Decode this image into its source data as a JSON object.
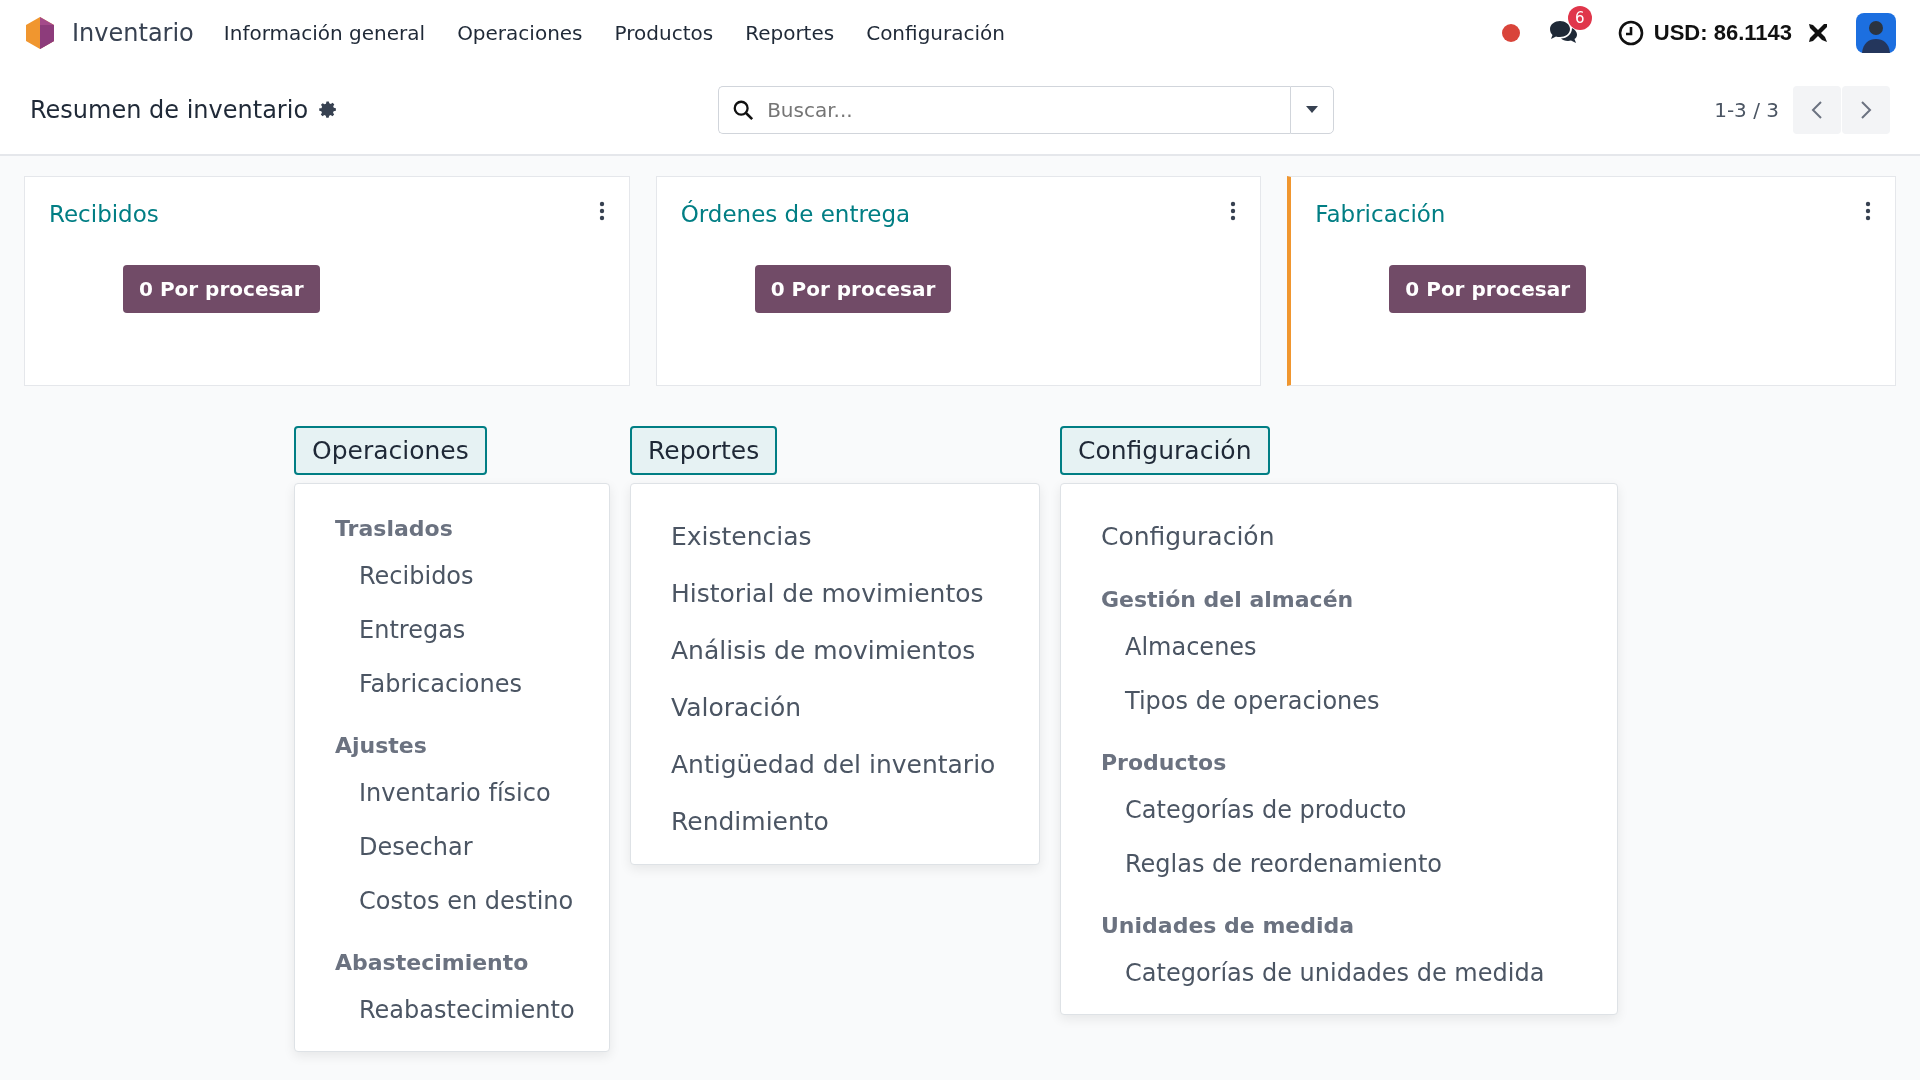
{
  "navbar": {
    "app_name": "Inventario",
    "menu": [
      "Información general",
      "Operaciones",
      "Productos",
      "Reportes",
      "Configuración"
    ],
    "messages_badge": "6",
    "currency": "USD: 86.1143"
  },
  "control_panel": {
    "title": "Resumen de inventario",
    "search": {
      "placeholder": "Buscar..."
    },
    "pager": "1-3 / 3"
  },
  "cards": [
    {
      "title": "Recibidos",
      "button": "0 Por procesar",
      "accent": false
    },
    {
      "title": "Órdenes de entrega",
      "button": "0 Por procesar",
      "accent": false
    },
    {
      "title": "Fabricación",
      "button": "0 Por procesar",
      "accent": true
    }
  ],
  "menus": [
    {
      "title": "Operaciones",
      "entries": [
        {
          "kind": "group",
          "label": "Traslados",
          "children": [
            {
              "label": "Recibidos"
            },
            {
              "label": "Entregas"
            },
            {
              "label": "Fabricaciones"
            }
          ]
        },
        {
          "kind": "group",
          "label": "Ajustes",
          "children": [
            {
              "label": "Inventario físico"
            },
            {
              "label": "Desechar"
            },
            {
              "label": "Costos en destino"
            }
          ]
        },
        {
          "kind": "group",
          "label": "Abastecimiento",
          "children": [
            {
              "label": "Reabastecimiento"
            }
          ]
        }
      ]
    },
    {
      "title": "Reportes",
      "entries": [
        {
          "kind": "item",
          "label": "Existencias"
        },
        {
          "kind": "item",
          "label": "Historial de movimientos"
        },
        {
          "kind": "item",
          "label": "Análisis de movimientos"
        },
        {
          "kind": "item",
          "label": "Valoración"
        },
        {
          "kind": "item",
          "label": "Antigüedad del inventario"
        },
        {
          "kind": "item",
          "label": "Rendimiento"
        }
      ]
    },
    {
      "title": "Configuración",
      "entries": [
        {
          "kind": "item",
          "label": "Configuración"
        },
        {
          "kind": "group",
          "label": "Gestión del almacén",
          "children": [
            {
              "label": "Almacenes"
            },
            {
              "label": "Tipos de operaciones"
            }
          ]
        },
        {
          "kind": "group",
          "label": "Productos",
          "children": [
            {
              "label": "Categorías de producto"
            },
            {
              "label": "Reglas de reordenamiento"
            }
          ]
        },
        {
          "kind": "group",
          "label": "Unidades de medida",
          "children": [
            {
              "label": "Categorías de unidades de medida"
            }
          ]
        }
      ]
    }
  ]
}
